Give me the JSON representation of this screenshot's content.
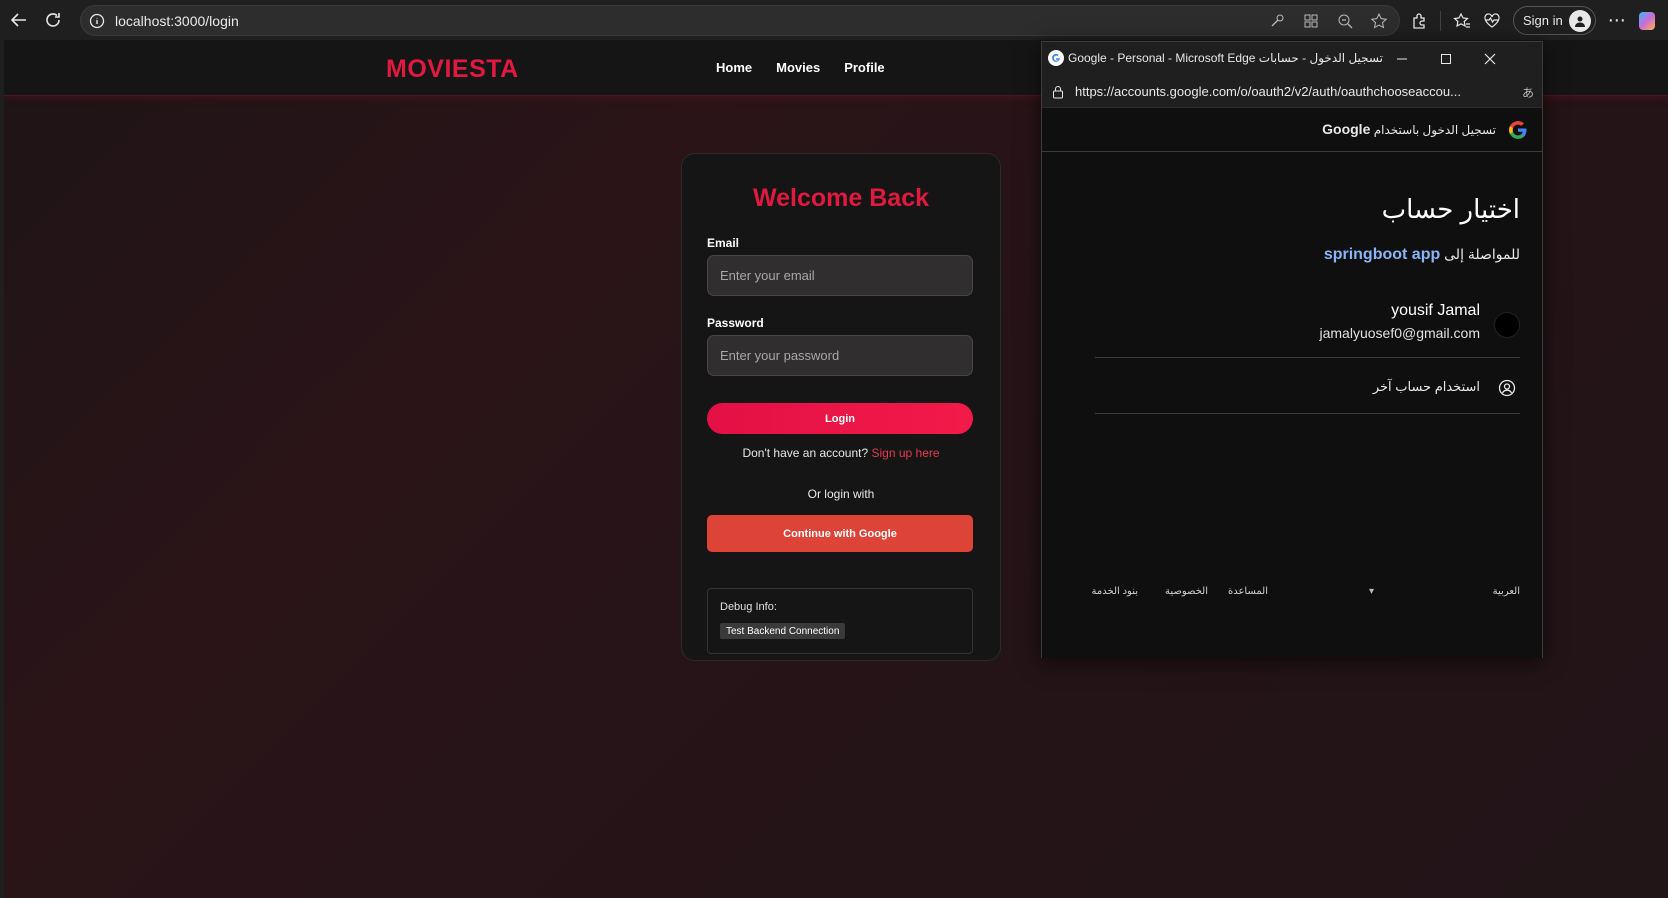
{
  "browser": {
    "url": "localhost:3000/login",
    "signin_label": "Sign in"
  },
  "site": {
    "brand": "MOVIESTA",
    "nav": [
      "Home",
      "Movies",
      "Profile"
    ]
  },
  "login": {
    "title": "Welcome Back",
    "email_label": "Email",
    "email_placeholder": "Enter your email",
    "password_label": "Password",
    "password_placeholder": "Enter your password",
    "login_button": "Login",
    "signup_prompt": "Don't have an account?",
    "signup_link": "Sign up here",
    "or_text": "Or login with",
    "google_button": "Continue with Google",
    "debug_title": "Debug Info:",
    "debug_button": "Test Backend Connection"
  },
  "popup": {
    "window_title": "Google - Personal - Microsoft Edge تسجيل الدخول - حسابات",
    "url": "https://accounts.google.com/o/oauth2/v2/auth/oauthchooseaccou...",
    "header_prefix": "تسجيل الدخول باستخدام",
    "header_brand": "Google",
    "choose_title": "اختيار حساب",
    "continue_prefix": "للمواصلة إلى",
    "app_name": "springboot app",
    "account_name": "yousif Jamal",
    "account_email": "jamalyuosef0@gmail.com",
    "use_other": "استخدام حساب آخر",
    "footer": {
      "language": "العربية",
      "help": "المساعدة",
      "privacy": "الخصوصية",
      "terms": "بنود الخدمة"
    }
  },
  "colors": {
    "brand_red": "#e0193f",
    "google_red": "#de4338",
    "link_blue": "#8ab4f8"
  }
}
